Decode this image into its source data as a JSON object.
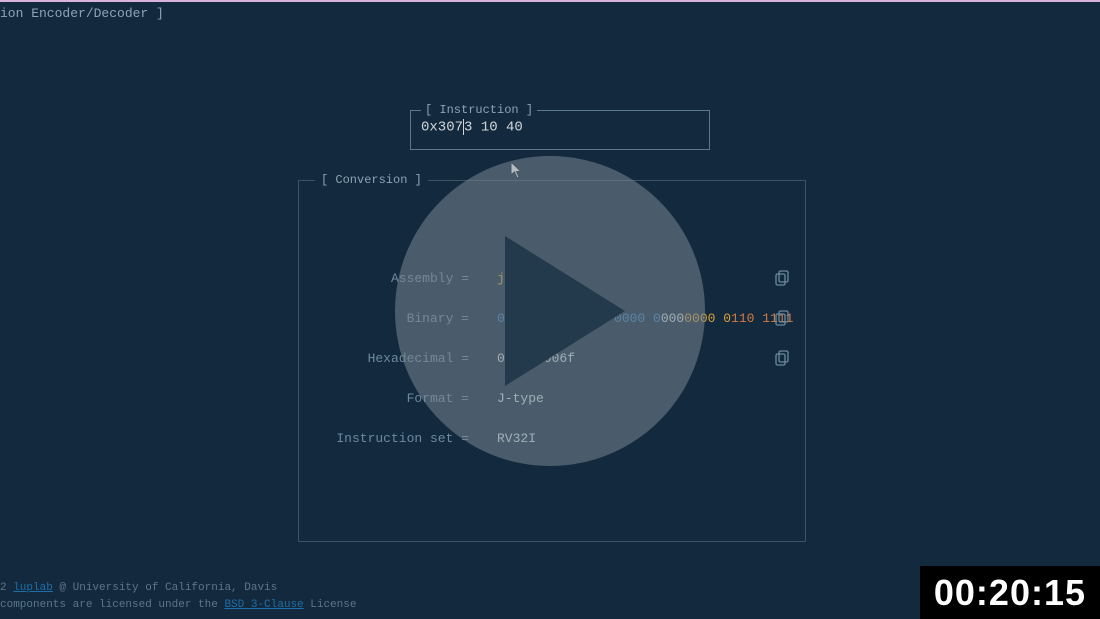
{
  "header": {
    "title": "ion Encoder/Decoder ]"
  },
  "instruction": {
    "label": "[ Instruction ]",
    "value_before": "0x307",
    "value_after": "3 10 40"
  },
  "conversion": {
    "label": "[ Conversion ]",
    "assembly": {
      "label": "Assembly =",
      "mnemonic": "jal ",
      "reg": "x0",
      "sep": ", ",
      "imm": "92"
    },
    "binary": {
      "label": "Binary =",
      "groups": [
        {
          "text": "0000 0101 1100 0000 0",
          "cls": "c-blue"
        },
        {
          "text": "000 ",
          "cls": "c-white"
        },
        {
          "text": "0000 0",
          "cls": "c-yellow"
        },
        {
          "text": "110 1111",
          "cls": "c-orange"
        }
      ]
    },
    "hex": {
      "label": "Hexadecimal =",
      "value": "0x05c0006f"
    },
    "format": {
      "label": "Format =",
      "value": "J-type"
    },
    "iset": {
      "label": "Instruction set =",
      "value": "RV32I"
    }
  },
  "footer": {
    "line1_prefix": "2 ",
    "line1_link": "luplab",
    "line1_suffix": " @ University of California, Davis",
    "line2_prefix": " components are licensed under the ",
    "line2_link": "BSD 3-Clause",
    "line2_suffix": " License"
  },
  "video": {
    "timestamp": "00:20:15"
  }
}
